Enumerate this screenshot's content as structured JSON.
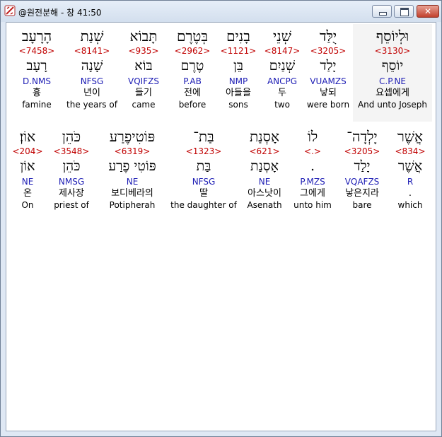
{
  "window": {
    "title": "@원전분해 - 창 41:50",
    "minimize_label": "",
    "maximize_label": "",
    "close_label": "✕"
  },
  "rows": [
    {
      "words": [
        {
          "hebrew": "הָרָעָב",
          "strong": "<7458>",
          "lexeme": "רָעָב",
          "morph": "D.NMS",
          "korean": "흉",
          "english": "famine"
        },
        {
          "hebrew": "שְׁנַת",
          "strong": "<8141>",
          "lexeme": "שָׁנָה",
          "morph": "NFSG",
          "korean": "년이",
          "english": "the years of"
        },
        {
          "hebrew": "תָּבוֹא",
          "strong": "<935>",
          "lexeme": "בּוֹא",
          "morph": "VQIFZS",
          "korean": "들기",
          "english": "came"
        },
        {
          "hebrew": "בְּטֶרֶם",
          "strong": "<2962>",
          "lexeme": "טֶרֶם",
          "morph": "P.AB",
          "korean": "전에",
          "english": "before"
        },
        {
          "hebrew": "בָנִים",
          "strong": "<1121>",
          "lexeme": "בֵּן",
          "morph": "NMP",
          "korean": "아들을",
          "english": "sons"
        },
        {
          "hebrew": "שְׁנֵי",
          "strong": "<8147>",
          "lexeme": "שְׁנַיִם",
          "morph": "ANCPG",
          "korean": "두",
          "english": "two"
        },
        {
          "hebrew": "יֻלַּד",
          "strong": "<3205>",
          "lexeme": "יָלַד",
          "morph": "VUAMZS",
          "korean": "낳되",
          "english": "were born"
        },
        {
          "hebrew": "וּלְיוֹסֵף",
          "strong": "<3130>",
          "lexeme": "יוֹסֵף",
          "morph": "C.P.NE",
          "korean": "요셉에게",
          "english": "And unto Joseph"
        }
      ]
    },
    {
      "words": [
        {
          "hebrew": "אוֹן׃",
          "strong": "<204>",
          "lexeme": "אוֹן",
          "morph": "NE",
          "korean": "온",
          "english": "On"
        },
        {
          "hebrew": "כֹּהֵן",
          "strong": "<3548>",
          "lexeme": "כֹּהֵן",
          "morph": "NMSG",
          "korean": "제사장",
          "english": "priest of"
        },
        {
          "hebrew": "פּוֹטִיפֶרַע",
          "strong": "<6319>",
          "lexeme": "פּוֹטִי פֶרַע",
          "morph": "NE",
          "korean": "보디베라의",
          "english": "Potipherah"
        },
        {
          "hebrew": "בַּת־",
          "strong": "<1323>",
          "lexeme": "בַּת",
          "morph": "NFSG",
          "korean": "딸",
          "english": "the daughter of"
        },
        {
          "hebrew": "אָסְנַת",
          "strong": "<621>",
          "lexeme": "אָסְנַת",
          "morph": "NE",
          "korean": "아스낫이",
          "english": "Asenath"
        },
        {
          "hebrew": "לוֹ",
          "strong": "<.>",
          "lexeme": ".",
          "morph": "P.MZS",
          "korean": "그에게",
          "english": "unto him"
        },
        {
          "hebrew": "יָלְדָה־",
          "strong": "<3205>",
          "lexeme": "יָלַד",
          "morph": "VQAFZS",
          "korean": "낳은지라",
          "english": "bare"
        },
        {
          "hebrew": "אֲשֶׁר",
          "strong": "<834>",
          "lexeme": "אֲשֶׁר",
          "morph": "R",
          "korean": ".",
          "english": "which"
        }
      ]
    }
  ]
}
